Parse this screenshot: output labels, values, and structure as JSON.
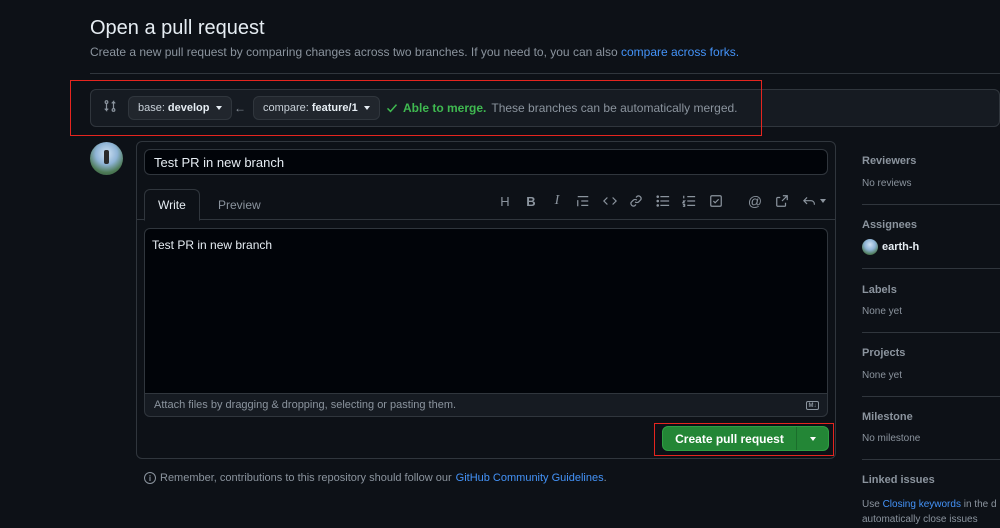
{
  "page": {
    "title": "Open a pull request",
    "subtitle": "Create a new pull request by comparing changes across two branches. If you need to, you can also",
    "subtitle_link": "compare across forks."
  },
  "compare": {
    "base_prefix": "base:",
    "base_branch": "develop",
    "compare_prefix": "compare:",
    "compare_branch": "feature/1",
    "arrow": "←",
    "status_ok": "Able to merge.",
    "status_text": "These branches can be automatically merged."
  },
  "form": {
    "title_value": "Test PR in new branch",
    "tabs": [
      "Write",
      "Preview"
    ],
    "toolbar_icons": [
      "heading-icon",
      "bold-icon",
      "italic-icon",
      "quote-icon",
      "code-icon",
      "link-icon",
      "unordered-list-icon",
      "ordered-list-icon",
      "task-list-icon",
      "mention-icon",
      "reference-icon",
      "undo-icon"
    ],
    "body_value": "Test PR in new branch",
    "attach_text": "Attach files by dragging & dropping, selecting or pasting them.",
    "markdown_badge": "M↓",
    "create_label": "Create pull request"
  },
  "notice": {
    "text": "Remember, contributions to this repository should follow our",
    "link": "GitHub Community Guidelines",
    "end": "."
  },
  "sidebar": {
    "reviewers_h": "Reviewers",
    "reviewers_v": "No reviews",
    "assignees_h": "Assignees",
    "assignee_user": "earth-h",
    "labels_h": "Labels",
    "labels_v": "None yet",
    "projects_h": "Projects",
    "projects_v": "None yet",
    "milestone_h": "Milestone",
    "milestone_v": "No milestone",
    "linked_h": "Linked issues",
    "linked_pre": "Use",
    "linked_link": "Closing keywords",
    "linked_post": "in the d",
    "linked_line2": "automatically close issues"
  },
  "colors": {
    "accent": "#4493f8",
    "success": "#3fb950",
    "button_green": "#238636",
    "highlight_red": "#e5251f"
  }
}
